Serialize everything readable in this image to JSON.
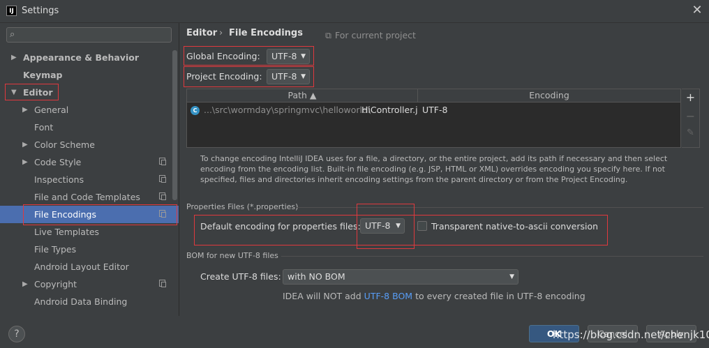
{
  "window": {
    "app_icon": "IJ",
    "title": "Settings",
    "close_glyph": "✕"
  },
  "sidebar": {
    "search_placeholder": "",
    "items": [
      {
        "label": "Appearance & Behavior",
        "arrow": "▶"
      },
      {
        "label": "Keymap"
      },
      {
        "label": "Editor",
        "arrow": "▼"
      },
      {
        "label": "General",
        "arrow": "▶"
      },
      {
        "label": "Font"
      },
      {
        "label": "Color Scheme",
        "arrow": "▶"
      },
      {
        "label": "Code Style",
        "arrow": "▶"
      },
      {
        "label": "Inspections"
      },
      {
        "label": "File and Code Templates"
      },
      {
        "label": "File Encodings"
      },
      {
        "label": "Live Templates"
      },
      {
        "label": "File Types"
      },
      {
        "label": "Android Layout Editor"
      },
      {
        "label": "Copyright",
        "arrow": "▶"
      },
      {
        "label": "Android Data Binding"
      }
    ]
  },
  "breadcrumb": {
    "parent": "Editor",
    "separator": "›",
    "current": "File Encodings",
    "scope_icon": "⧉",
    "scope": "For current project"
  },
  "encodings": {
    "global_label": "Global Encoding:",
    "global_value": "UTF-8",
    "project_label": "Project Encoding:",
    "project_value": "UTF-8",
    "caret": "▼"
  },
  "table": {
    "col_path": "Path ▲",
    "col_encoding": "Encoding",
    "rows": [
      {
        "path_prefix": "...\\src\\wormday\\springmvc\\helloworld\\",
        "file": "HiController.ja",
        "encoding": "UTF-8",
        "icon_letter": "C"
      }
    ],
    "tool_add": "+",
    "tool_remove": "−",
    "tool_edit": "✎"
  },
  "help_text": "To change encoding IntelliJ IDEA uses for a file, a directory, or the entire project, add its path if necessary and then select encoding from the encoding list. Built-in file encoding (e.g. JSP, HTML or XML) overrides encoding you specify here. If not specified, files and directories inherit encoding settings from the parent directory or from the Project Encoding.",
  "properties": {
    "section_title": "Properties Files (*.properties)",
    "default_label": "Default encoding for properties files:",
    "default_value": "UTF-8",
    "native_label": "Transparent native-to-ascii conversion",
    "native_checked": false
  },
  "bom": {
    "section_title": "BOM for new UTF-8 files",
    "create_label": "Create UTF-8 files:",
    "create_value": "with NO BOM",
    "note_prefix": "IDEA will NOT add",
    "note_link": "UTF-8 BOM",
    "note_suffix": "to every created file in UTF-8 encoding"
  },
  "footer": {
    "help": "?",
    "ok": "OK",
    "cancel": "Cancel",
    "apply": "Apply",
    "watermark": "https://blog.csdn.net/chenjk10"
  },
  "colors": {
    "background": "#3c3f41",
    "selection": "#4b6eaf",
    "highlight_box": "#e0393e",
    "link": "#589df6"
  }
}
